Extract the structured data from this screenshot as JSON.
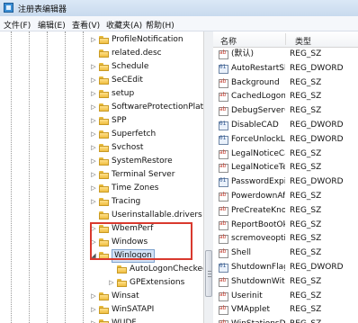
{
  "window": {
    "title": "注册表编辑器"
  },
  "menu": [
    "文件(F)",
    "编辑(E)",
    "查看(V)",
    "收藏夹(A)",
    "帮助(H)"
  ],
  "tree": {
    "items": [
      {
        "label": "ProfileNotification",
        "expander": "▷"
      },
      {
        "label": "related.desc",
        "expander": ""
      },
      {
        "label": "Schedule",
        "expander": "▷"
      },
      {
        "label": "SeCEdit",
        "expander": "▷"
      },
      {
        "label": "setup",
        "expander": "▷"
      },
      {
        "label": "SoftwareProtectionPlatf",
        "expander": "▷"
      },
      {
        "label": "SPP",
        "expander": "▷"
      },
      {
        "label": "Superfetch",
        "expander": "▷"
      },
      {
        "label": "Svchost",
        "expander": "▷"
      },
      {
        "label": "SystemRestore",
        "expander": "▷"
      },
      {
        "label": "Terminal Server",
        "expander": "▷"
      },
      {
        "label": "Time Zones",
        "expander": "▷"
      },
      {
        "label": "Tracing",
        "expander": "▷"
      },
      {
        "label": "Userinstallable.drivers",
        "expander": ""
      },
      {
        "label": "WbemPerf",
        "expander": "▷"
      },
      {
        "label": "Windows",
        "expander": "▷"
      },
      {
        "label": "Winlogon",
        "expander": "◢"
      },
      {
        "label": "AutoLogonChecked",
        "expander": ""
      },
      {
        "label": "GPExtensions",
        "expander": "▷"
      },
      {
        "label": "Winsat",
        "expander": "▷"
      },
      {
        "label": "WinSATAPI",
        "expander": "▷"
      },
      {
        "label": "WUDF",
        "expander": "▷"
      }
    ]
  },
  "list": {
    "header": {
      "name": "名称",
      "type": "类型"
    },
    "rows": [
      {
        "name": "(默认)",
        "type": "REG_SZ",
        "kind": "sz"
      },
      {
        "name": "AutoRestartShell",
        "type": "REG_DWORD",
        "kind": "dw"
      },
      {
        "name": "Background",
        "type": "REG_SZ",
        "kind": "sz"
      },
      {
        "name": "CachedLogons...",
        "type": "REG_SZ",
        "kind": "sz"
      },
      {
        "name": "DebugServerC...",
        "type": "REG_SZ",
        "kind": "sz"
      },
      {
        "name": "DisableCAD",
        "type": "REG_DWORD",
        "kind": "dw"
      },
      {
        "name": "ForceUnlockLo...",
        "type": "REG_DWORD",
        "kind": "dw"
      },
      {
        "name": "LegalNoticeCa...",
        "type": "REG_SZ",
        "kind": "sz"
      },
      {
        "name": "LegalNoticeText",
        "type": "REG_SZ",
        "kind": "sz"
      },
      {
        "name": "PasswordExpir...",
        "type": "REG_DWORD",
        "kind": "dw"
      },
      {
        "name": "PowerdownAft...",
        "type": "REG_SZ",
        "kind": "sz"
      },
      {
        "name": "PreCreateKno...",
        "type": "REG_SZ",
        "kind": "sz"
      },
      {
        "name": "ReportBootOk",
        "type": "REG_SZ",
        "kind": "sz"
      },
      {
        "name": "scremoveoption",
        "type": "REG_SZ",
        "kind": "sz"
      },
      {
        "name": "Shell",
        "type": "REG_SZ",
        "kind": "sz"
      },
      {
        "name": "ShutdownFlags",
        "type": "REG_DWORD",
        "kind": "dw"
      },
      {
        "name": "ShutdownWith...",
        "type": "REG_SZ",
        "kind": "sz"
      },
      {
        "name": "Userinit",
        "type": "REG_SZ",
        "kind": "sz"
      },
      {
        "name": "VMApplet",
        "type": "REG_SZ",
        "kind": "sz"
      },
      {
        "name": "WinStationsDi...",
        "type": "REG_SZ",
        "kind": "sz"
      }
    ]
  },
  "colors": {
    "highlight_box": "#d9392e",
    "selection": "#d3e3f6"
  }
}
